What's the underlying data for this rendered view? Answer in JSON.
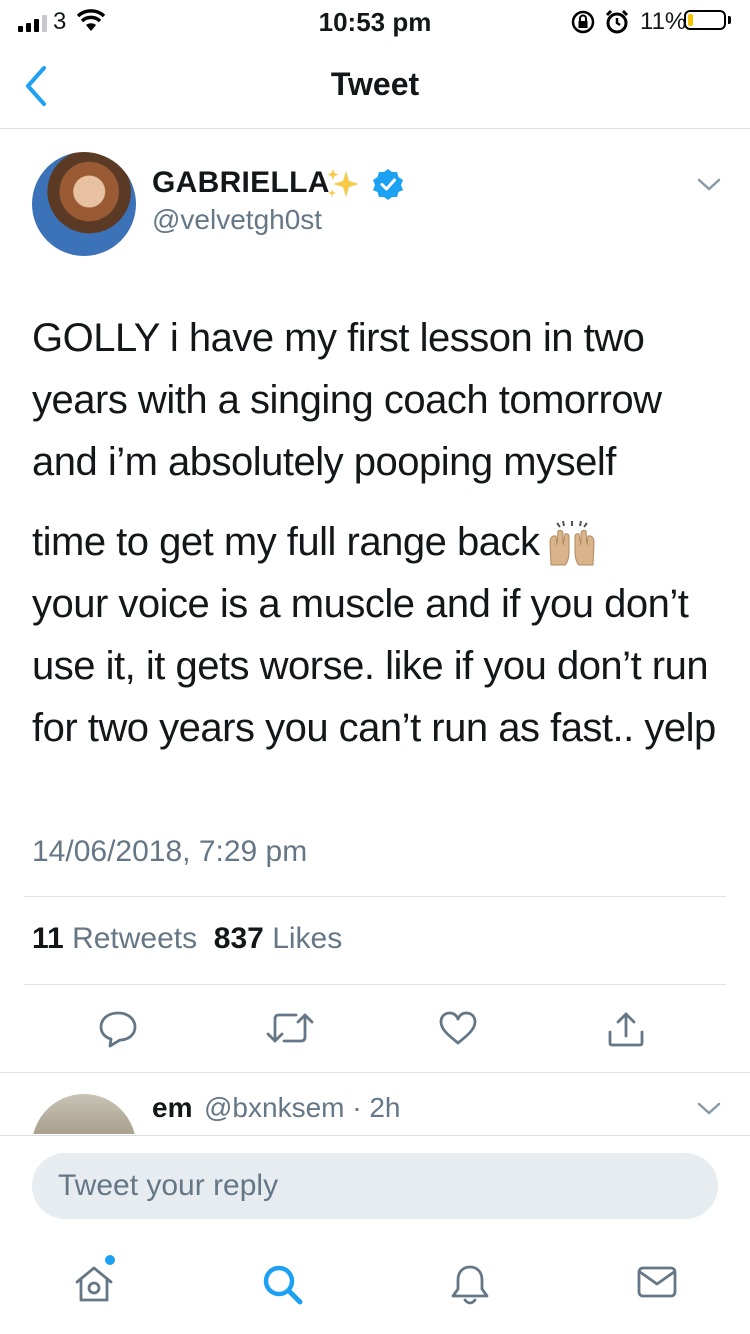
{
  "status_bar": {
    "carrier": "3",
    "time": "10:53 pm",
    "battery_percent": "11%"
  },
  "nav": {
    "title": "Tweet"
  },
  "tweet": {
    "author_name": "GABRIELLA",
    "author_handle": "@velvetgh0st",
    "paragraph_1": "GOLLY i have my first lesson in two years with a singing coach tomorrow and i’m absolutely pooping myself",
    "paragraph_2_line_1": "time to get my full range back",
    "paragraph_2_rest": "your voice is a muscle and if you don’t use it, it gets worse. like if you don’t run for two years you can’t run as fast.. yelp",
    "timestamp": "14/06/2018, 7:29 pm",
    "retweets_count": "11",
    "retweets_label": "Retweets",
    "likes_count": "837",
    "likes_label": "Likes"
  },
  "reply_preview": {
    "name": "em",
    "handle_time": "@bxnksem · 2h"
  },
  "reply_box": {
    "placeholder": "Tweet your reply"
  },
  "colors": {
    "accent": "#1da1f2",
    "secondary_text": "#657786",
    "action_icon": "#657786"
  },
  "icons": {
    "tabbar": [
      "home-icon",
      "search-icon",
      "notifications-icon",
      "messages-icon"
    ],
    "actions": [
      "reply-icon",
      "retweet-icon",
      "like-icon",
      "share-icon"
    ]
  }
}
